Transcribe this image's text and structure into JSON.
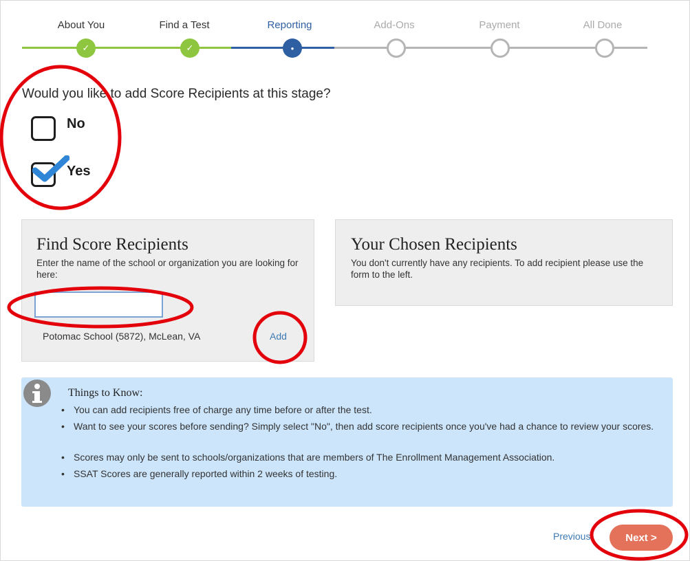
{
  "stepper": {
    "steps": [
      {
        "label": "About You",
        "state": "done"
      },
      {
        "label": "Find a Test",
        "state": "done"
      },
      {
        "label": "Reporting",
        "state": "current"
      },
      {
        "label": "Add-Ons",
        "state": "future"
      },
      {
        "label": "Payment",
        "state": "future"
      },
      {
        "label": "All Done",
        "state": "future"
      }
    ],
    "check_glyph": "✓",
    "current_glyph": "•"
  },
  "question": "Would you like to add Score Recipients at this stage?",
  "options": {
    "no": {
      "label": "No",
      "checked": false
    },
    "yes": {
      "label": "Yes",
      "checked": true
    }
  },
  "find_panel": {
    "title": "Find Score Recipients",
    "instructions": "Enter the name of the school or organization you are looking for here:",
    "search_value": "",
    "result": "Potomac School (5872), McLean, VA",
    "add_label": "Add"
  },
  "chosen_panel": {
    "title": "Your Chosen Recipients",
    "empty_message": "You don't currently have any recipients. To add recipient please use the form to the left."
  },
  "info": {
    "icon": "info-icon",
    "title": "Things to Know:",
    "items": [
      "You can add recipients free of charge any time before or after the test.",
      "Want to see your scores before sending? Simply select \"No\", then add score recipients once you've had a chance to review your scores.",
      "Scores may only be sent to schools/organizations that are members of The Enrollment Management Association.",
      "SSAT Scores are generally reported within 2 weeks of testing."
    ]
  },
  "nav": {
    "previous_label": "Previous",
    "next_label": "Next >"
  },
  "colors": {
    "done": "#8ec63f",
    "current": "#2e5fa3",
    "future": "#b5b5b5",
    "next_button": "#e4725a",
    "info_background": "#cce5fb",
    "annotation_red": "#e3000b",
    "checkmark_blue": "#2f86d6"
  }
}
